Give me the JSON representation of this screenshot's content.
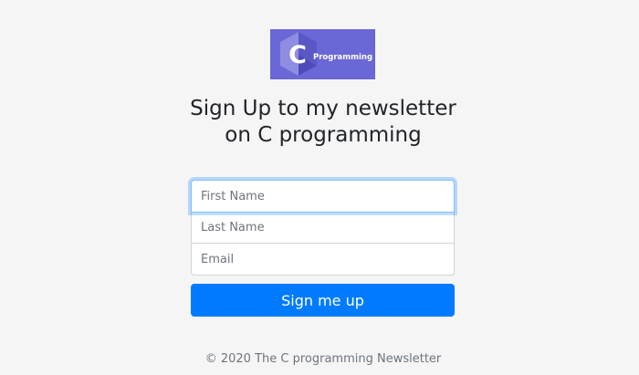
{
  "logo": {
    "icon": "c-language-hexagon-icon",
    "letter": "C",
    "text": "Programming",
    "colors": {
      "background": "#6a67d6",
      "hex_light": "#9b9ae8",
      "hex_dark": "#4f4cb8",
      "text": "#ffffff"
    }
  },
  "heading": "Sign Up to my newsletter on C programming",
  "form": {
    "first_name_placeholder": "First Name",
    "last_name_placeholder": "Last Name",
    "email_placeholder": "Email",
    "submit_label": "Sign me up"
  },
  "footer": "© 2020 The C programming Newsletter",
  "colors": {
    "background": "#f5f5f5",
    "primary": "#007bff",
    "focus_border": "#80bdff",
    "heading_text": "#212529",
    "muted_text": "#6c757d"
  }
}
